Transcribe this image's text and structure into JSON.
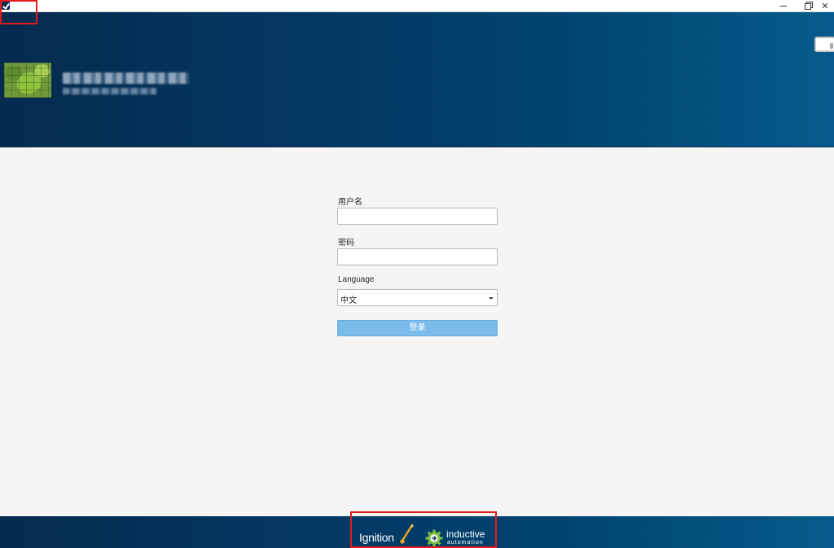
{
  "window": {
    "controls": {
      "minimize": "—",
      "restore": "❐",
      "close": "✕"
    }
  },
  "header": {
    "logo_alt": "company-logo",
    "title_redacted": true
  },
  "login": {
    "username_label": "用户名",
    "username_value": "",
    "password_label": "密码",
    "password_value": "",
    "language_label": "Language",
    "language_value": "中文",
    "submit_label": "登录"
  },
  "footer": {
    "brand_primary": "Ignition",
    "brand_secondary": "inductive",
    "brand_secondary_sub": "automation"
  },
  "colors": {
    "header_dark": "#052b4f",
    "header_light": "#075b8c",
    "button": "#7bbbea",
    "annotation": "#e31b1b",
    "spark": "#f5a623",
    "gear": "#7dc142"
  }
}
